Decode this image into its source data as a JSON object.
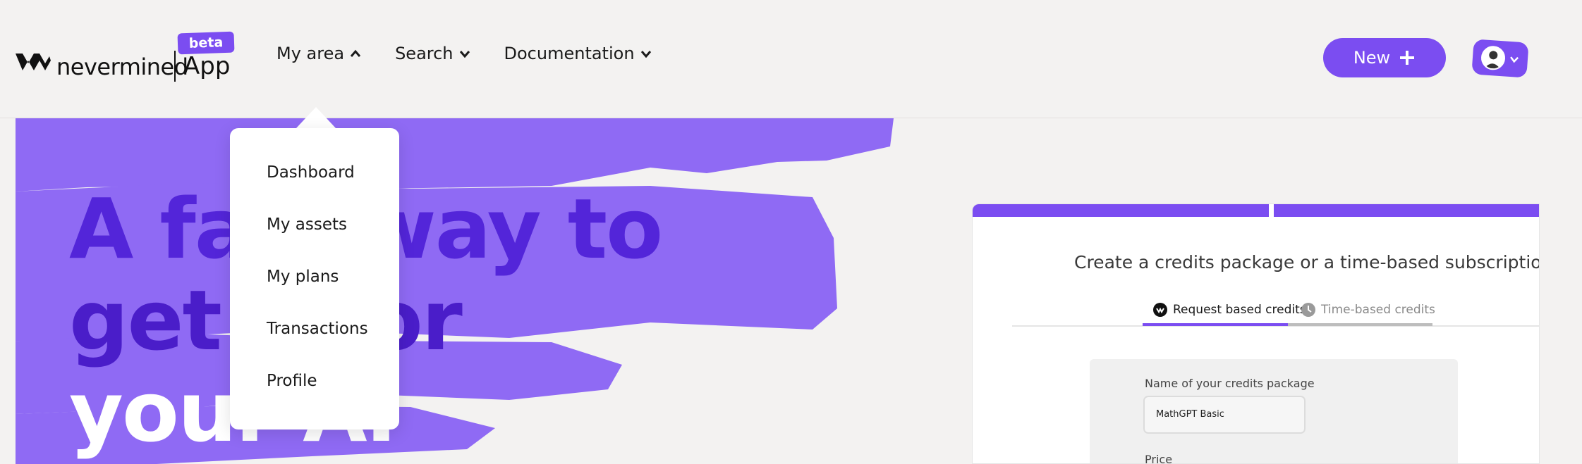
{
  "header": {
    "logo_word": "nevermined",
    "logo_app": "App",
    "beta_badge": "beta",
    "nav": [
      {
        "label": "My area",
        "icon": "chevron-up-icon"
      },
      {
        "label": "Search",
        "icon": "chevron-down-icon"
      },
      {
        "label": "Documentation",
        "icon": "chevron-down-icon"
      }
    ],
    "new_button": "New",
    "avatar_icon": "user-avatar"
  },
  "dropdown": {
    "items": [
      "Dashboard",
      "My assets",
      "My plans",
      "Transactions",
      "Profile"
    ]
  },
  "hero": {
    "line1": "A fa",
    "line1b": "way to",
    "line2": "get",
    "line2b": "for",
    "line3": "your AI"
  },
  "card": {
    "title": "Create a credits package or a time-based subscription",
    "tab_active": "Request based credits",
    "tab_inactive": "Time-based credits",
    "name_label": "Name of your credits package",
    "name_value": "MathGPT Basic",
    "price_label": "Price"
  },
  "colors": {
    "accent": "#7b4df1",
    "hero_text": "#5325d9",
    "background": "#f3f2f1"
  }
}
